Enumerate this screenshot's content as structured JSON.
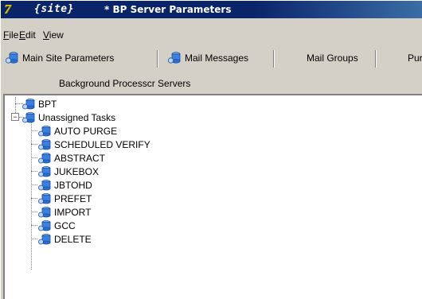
{
  "window": {
    "app_icon_glyph": "7",
    "title_site": "{site}",
    "title_text": "* BP Server Parameters"
  },
  "menu": [
    {
      "prefix": "",
      "accel": "F",
      "rest": "ile"
    },
    {
      "prefix": "",
      "accel": "E",
      "rest": "dit"
    },
    {
      "prefix": "",
      "accel": "V",
      "rest": "iew"
    }
  ],
  "toolbar": {
    "tabs": [
      {
        "label": "Main Site Parameters",
        "icon": "database-icon"
      },
      {
        "label": "Mail Messages",
        "icon": "database-icon"
      },
      {
        "label": "Mail Groups",
        "icon": ""
      },
      {
        "label": "Pur",
        "icon": ""
      }
    ]
  },
  "section_label": "Background Processcr Servers",
  "tree": {
    "root_items": [
      {
        "label": "BPT",
        "expander": ""
      },
      {
        "label": "Unassigned Tasks",
        "expander": "−"
      }
    ],
    "children": [
      "AUTO PURGE",
      "SCHEDULED VERIFY",
      "ABSTRACT",
      "JUKEBOX",
      "JBTOHD",
      "PREFET",
      "IMPORT",
      "GCC",
      "DELETE"
    ]
  },
  "colors": {
    "titlebar": "#0a246a",
    "chrome": "#d4d0c8",
    "icon_blue": "#2a6fd1"
  }
}
